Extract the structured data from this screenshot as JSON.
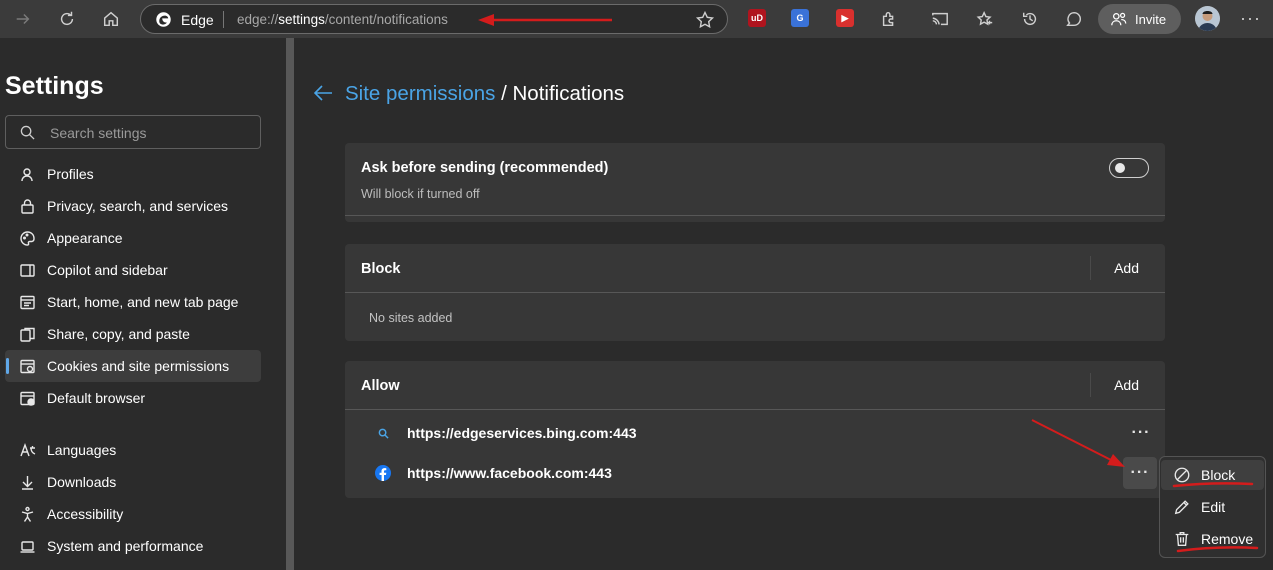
{
  "browser": {
    "edge_label": "Edge",
    "url_prefix": "edge://",
    "url_path": "settings",
    "url_rest": "/content/notifications",
    "invite_label": "Invite",
    "extensions": [
      {
        "name": "ublock-extension-icon",
        "text": "uD",
        "color": "#b0141e"
      },
      {
        "name": "translate-extension-icon",
        "text": "G",
        "color": "#3a72d8"
      },
      {
        "name": "video-extension-icon",
        "text": "▶",
        "color": "#d9302e"
      }
    ]
  },
  "sidebar": {
    "title": "Settings",
    "search_placeholder": "Search settings",
    "items": [
      {
        "label": "Profiles",
        "icon": "profile-icon"
      },
      {
        "label": "Privacy, search, and services",
        "icon": "lock-icon"
      },
      {
        "label": "Appearance",
        "icon": "palette-icon"
      },
      {
        "label": "Copilot and sidebar",
        "icon": "sidebar-icon"
      },
      {
        "label": "Start, home, and new tab page",
        "icon": "home-page-icon"
      },
      {
        "label": "Share, copy, and paste",
        "icon": "share-icon"
      },
      {
        "label": "Cookies and site permissions",
        "icon": "cookies-icon",
        "active": true
      },
      {
        "label": "Default browser",
        "icon": "default-browser-icon"
      },
      {
        "label": "Languages",
        "icon": "languages-icon"
      },
      {
        "label": "Downloads",
        "icon": "download-icon"
      },
      {
        "label": "Accessibility",
        "icon": "accessibility-icon"
      },
      {
        "label": "System and performance",
        "icon": "laptop-icon"
      }
    ]
  },
  "main": {
    "breadcrumb_link": "Site permissions",
    "breadcrumb_sep": " / ",
    "breadcrumb_current": "Notifications",
    "ask_card": {
      "title": "Ask before sending (recommended)",
      "subtitle": "Will block if turned off",
      "toggle_on": false
    },
    "block_card": {
      "title": "Block",
      "add_label": "Add",
      "empty_text": "No sites added"
    },
    "allow_card": {
      "title": "Allow",
      "add_label": "Add",
      "sites": [
        {
          "url": "https://edgeservices.bing.com:443",
          "icon": "search-icon"
        },
        {
          "url": "https://www.facebook.com:443",
          "icon": "facebook-icon"
        }
      ]
    }
  },
  "context_menu": {
    "items": [
      {
        "label": "Block",
        "icon": "block-icon"
      },
      {
        "label": "Edit",
        "icon": "pencil-icon"
      },
      {
        "label": "Remove",
        "icon": "trash-icon"
      }
    ]
  },
  "colors": {
    "accent": "#4aa4e6",
    "annotation": "#d41c1c",
    "facebook": "#1877f2"
  }
}
